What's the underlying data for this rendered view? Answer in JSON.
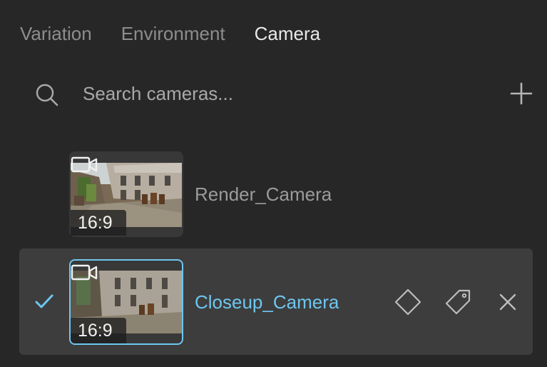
{
  "tabs": [
    {
      "label": "Variation",
      "active": false
    },
    {
      "label": "Environment",
      "active": false
    },
    {
      "label": "Camera",
      "active": true
    }
  ],
  "search": {
    "placeholder": "Search cameras...",
    "value": ""
  },
  "icons": {
    "search": "search-icon",
    "add": "plus-icon",
    "check": "check-icon",
    "camera": "video-camera-icon",
    "diamond": "diamond-icon",
    "tag": "tag-icon",
    "close": "close-icon"
  },
  "cameras": [
    {
      "name": "Render_Camera",
      "aspect": "16:9",
      "selected": false
    },
    {
      "name": "Closeup_Camera",
      "aspect": "16:9",
      "selected": true
    }
  ],
  "colors": {
    "background": "#272727",
    "selected_row": "#3d3d3d",
    "accent": "#6ec6ef",
    "text_muted": "#8d8d8d",
    "text_active": "#e8e8e8"
  }
}
